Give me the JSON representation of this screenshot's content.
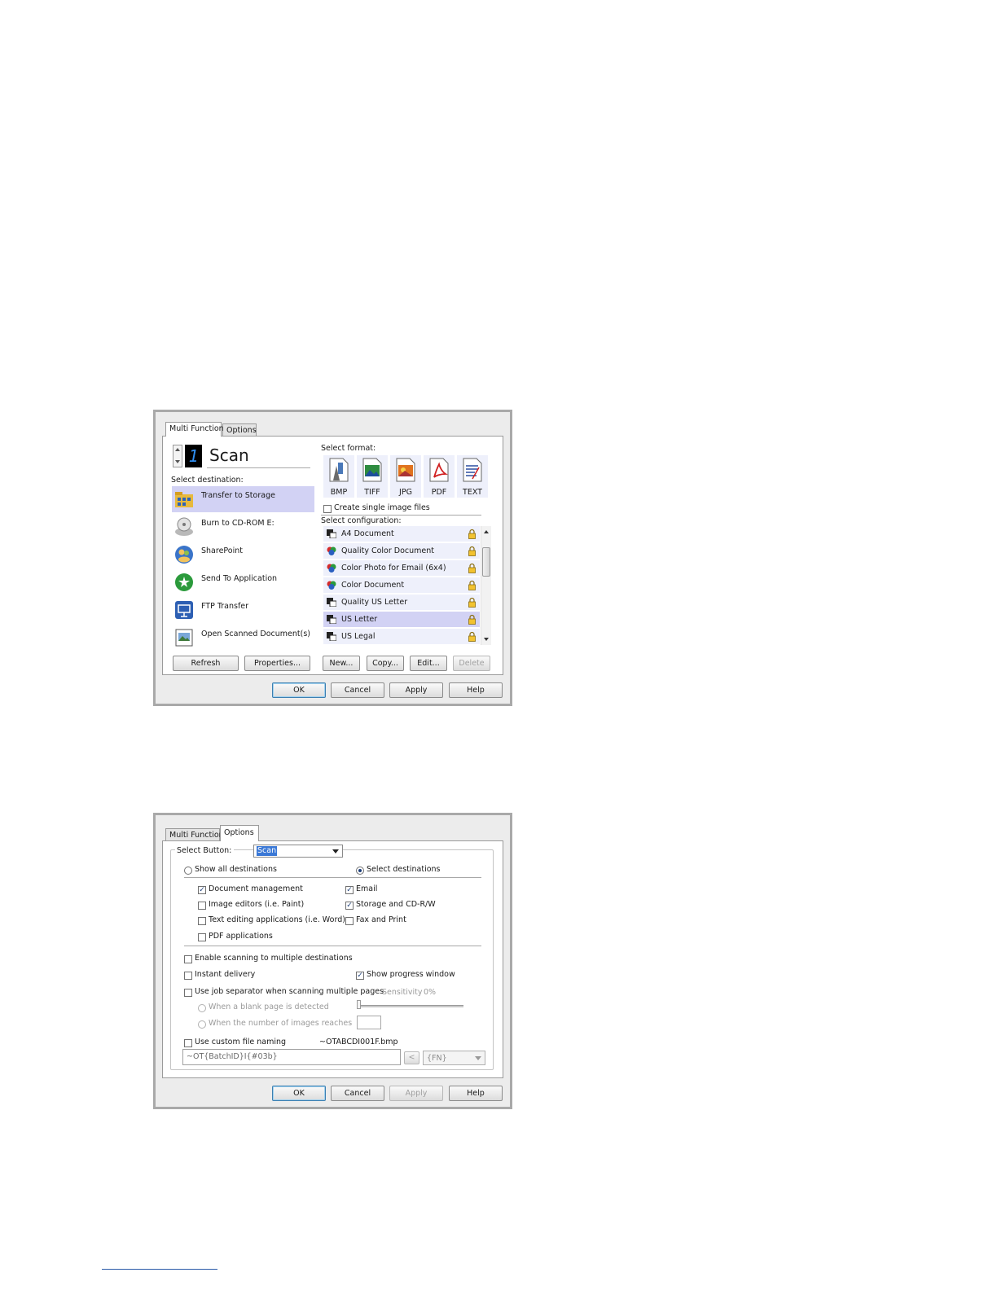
{
  "dialog1": {
    "tabs": [
      "Multi Function",
      "Options"
    ],
    "button_number": "1",
    "button_name": "Scan",
    "select_destination_label": "Select destination:",
    "destinations": [
      {
        "label": "Transfer to Storage",
        "icon": "storage-folder-icon",
        "selected": true
      },
      {
        "label": "Burn to CD-ROM  E:",
        "icon": "cd-rom-icon",
        "selected": false
      },
      {
        "label": "SharePoint",
        "icon": "sharepoint-icon",
        "selected": false
      },
      {
        "label": "Send To Application",
        "icon": "send-to-application-icon",
        "selected": false
      },
      {
        "label": "FTP Transfer",
        "icon": "ftp-transfer-icon",
        "selected": false
      },
      {
        "label": "Open Scanned Document(s)",
        "icon": "open-document-icon",
        "selected": false
      }
    ],
    "select_format_label": "Select format:",
    "formats": [
      "BMP",
      "TIFF",
      "JPG",
      "PDF",
      "TEXT"
    ],
    "create_single_image_label": "Create single image files",
    "select_configuration_label": "Select configuration:",
    "configurations": [
      {
        "label": "A4 Document",
        "icon": "bw-document-icon",
        "selected": false
      },
      {
        "label": "Quality Color Document",
        "icon": "color-document-icon",
        "selected": false
      },
      {
        "label": "Color Photo for Email (6x4)",
        "icon": "color-document-icon",
        "selected": false
      },
      {
        "label": "Color Document",
        "icon": "color-document-icon",
        "selected": false
      },
      {
        "label": "Quality US Letter",
        "icon": "bw-document-icon",
        "selected": false
      },
      {
        "label": "US Letter",
        "icon": "bw-document-icon",
        "selected": true
      },
      {
        "label": "US Legal",
        "icon": "bw-document-icon",
        "selected": false
      }
    ],
    "buttons": {
      "refresh": "Refresh",
      "properties": "Properties...",
      "new": "New...",
      "copy": "Copy...",
      "edit": "Edit...",
      "delete": "Delete",
      "ok": "OK",
      "cancel": "Cancel",
      "apply": "Apply",
      "help": "Help"
    }
  },
  "dialog2": {
    "tabs": [
      "Multi Function",
      "Options"
    ],
    "select_button_label": "Select Button:",
    "select_button_value": "Scan",
    "show_all_destinations": "Show all destinations",
    "select_destinations": "Select destinations",
    "destination_types": [
      {
        "label": "Document management",
        "checked": true
      },
      {
        "label": "Email",
        "checked": true
      },
      {
        "label": "Image editors (i.e. Paint)",
        "checked": false
      },
      {
        "label": "Storage and CD-R/W",
        "checked": true
      },
      {
        "label": "Text editing applications (i.e. Word)",
        "checked": false
      },
      {
        "label": "Fax and Print",
        "checked": false
      },
      {
        "label": "PDF applications",
        "checked": false
      }
    ],
    "enable_multiple": "Enable scanning to multiple destinations",
    "instant_delivery": "Instant delivery",
    "show_progress": "Show progress window",
    "job_separator": "Use job separator when scanning multiple pages",
    "sensitivity_label": "Sensitivity",
    "sensitivity_value": "0%",
    "blank_page": "When a blank page is detected",
    "images_reaches": "When the number of images reaches",
    "custom_naming": "Use custom file naming",
    "file_preview": "~OTABCDI001F.bmp",
    "naming_pattern": "~OT{BatchID}I{#03b}",
    "insert_button": "<",
    "token_value": "{FN}",
    "buttons": {
      "ok": "OK",
      "cancel": "Cancel",
      "apply": "Apply",
      "help": "Help"
    }
  }
}
